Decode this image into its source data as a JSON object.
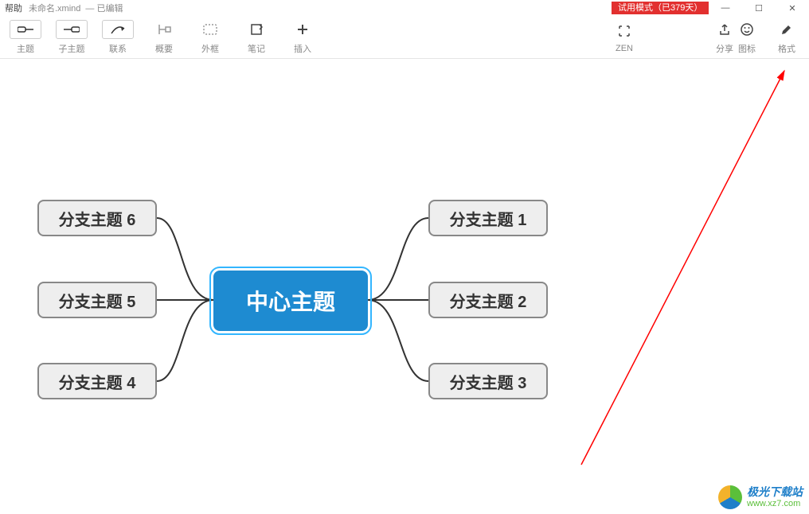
{
  "titlebar": {
    "help": "帮助",
    "filename": "未命名.xmind",
    "edited": "— 已编辑"
  },
  "trial_badge": "试用模式（已379天）",
  "window": {
    "min": "—",
    "max": "☐",
    "close": "✕"
  },
  "toolbar": {
    "left": [
      {
        "id": "topic-button",
        "icon": "topic-icon",
        "label": "主题"
      },
      {
        "id": "subtopic-button",
        "icon": "subtopic-icon",
        "label": "子主题"
      },
      {
        "id": "relationship-button",
        "icon": "relationship-icon",
        "label": "联系"
      },
      {
        "id": "summary-button",
        "icon": "summary-icon",
        "label": "概要"
      },
      {
        "id": "boundary-button",
        "icon": "boundary-icon",
        "label": "外框"
      },
      {
        "id": "note-button",
        "icon": "note-icon",
        "label": "笔记"
      },
      {
        "id": "insert-button",
        "icon": "insert-icon",
        "label": "插入"
      }
    ],
    "right": [
      {
        "id": "zen-button",
        "icon": "zen-icon",
        "label": "ZEN"
      },
      {
        "id": "share-button",
        "icon": "share-icon",
        "label": "分享"
      }
    ],
    "far_right": [
      {
        "id": "icons-button",
        "icon": "smiley-icon",
        "label": "图标"
      },
      {
        "id": "format-button",
        "icon": "format-icon",
        "label": "格式"
      }
    ]
  },
  "mindmap": {
    "central": "中心主题",
    "branches_right": [
      "分支主题 1",
      "分支主题 2",
      "分支主题 3"
    ],
    "branches_left": [
      "分支主题 6",
      "分支主题 5",
      "分支主题 4"
    ]
  },
  "watermark": {
    "name": "极光下载站",
    "url": "www.xz7.com"
  }
}
